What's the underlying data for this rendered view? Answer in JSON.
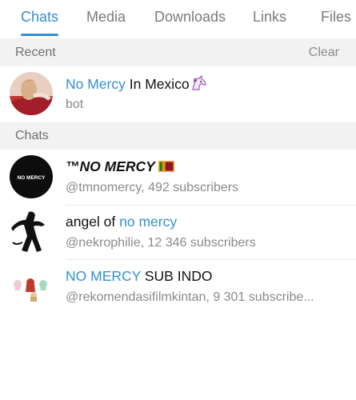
{
  "tabs": [
    {
      "label": "Chats"
    },
    {
      "label": "Media"
    },
    {
      "label": "Downloads"
    },
    {
      "label": "Links"
    },
    {
      "label": "Files"
    }
  ],
  "recent": {
    "label": "Recent",
    "clear_label": "Clear",
    "items": [
      {
        "title_highlight": "No Mercy",
        "title_rest": " In Mexico",
        "subtitle": "bot",
        "emoji": "unicorn-icon"
      }
    ]
  },
  "chats": {
    "label": "Chats",
    "items": [
      {
        "title": "™NO MERCY",
        "subtitle": "@tmnomercy, 492 subscribers",
        "emoji": "sri-lanka-flag-icon",
        "avatar_text": "NO MERCY"
      },
      {
        "title_prefix": "angel of ",
        "title_highlight": "no mercy",
        "subtitle": "@nekrophilie, 12 346 subscribers"
      },
      {
        "title_highlight": "NO MERCY",
        "title_rest": " SUB INDO",
        "subtitle": "@rekomendasifilmkintan, 9 301 subscribe..."
      }
    ]
  },
  "colors": {
    "accent": "#3390d0",
    "section_bg": "#f2f2f2",
    "muted_text": "#8a8a8a"
  }
}
